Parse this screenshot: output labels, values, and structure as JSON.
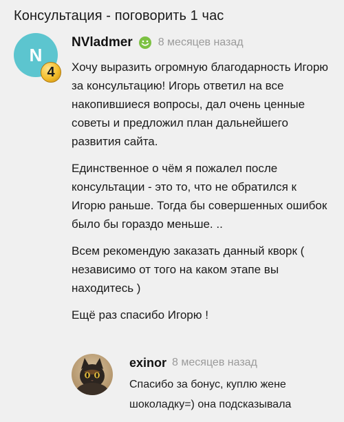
{
  "page": {
    "title": "Консультация - поговорить 1 час"
  },
  "review": {
    "avatar_letter": "N",
    "level": "4",
    "username": "NVladmer",
    "status_icon": "smile-icon",
    "time": "8 месяцев назад",
    "paragraphs": [
      "Хочу выразить огромную благодарность Игорю за консультацию! Игорь ответил на все накопившиеся вопросы, дал очень ценные советы и предложил план дальнейшего развития сайта.",
      "Единственное о чём я пожалел после консультации - это то, что не обратился к Игорю раньше. Тогда бы совершенных ошибок было бы гораздо меньше. ..",
      "Всем рекомендую заказать данный кворк ( независимо от того на каком этапе вы находитесь )",
      "Ещё раз спасибо Игорю !"
    ],
    "colors": {
      "avatar_bg": "#5cc5cf",
      "status_green": "#7cc142"
    }
  },
  "reply": {
    "avatar_icon": "cat-photo-avatar",
    "username": "exinor",
    "time": "8 месяцев назад",
    "text": "Спасибо за бонус, куплю жене шоколадку=) она подсказывала"
  }
}
